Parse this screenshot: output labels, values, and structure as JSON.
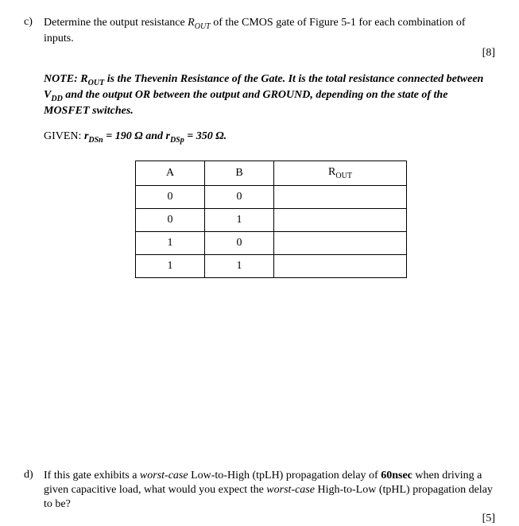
{
  "question_c": {
    "letter": "c)",
    "text_prefix": "Determine the output resistance ",
    "rout_symbol": "R",
    "rout_sub": "OUT",
    "text_middle": " of the CMOS gate of Figure 5-1 for each combination of inputs.",
    "marks": "[8]"
  },
  "note": {
    "label": "NOTE:  ",
    "r_prefix": "R",
    "r_sub": "OUT",
    "text1": " is the Thevenin Resistance of the Gate.  It is the total resistance connected between V",
    "vdd_sub": "DD",
    "text2": " and the output OR between the output and GROUND, depending on the state of the MOSFET switches."
  },
  "given": {
    "label": "GIVEN:   ",
    "rdsn_prefix": "r",
    "rdsn_sub": "DSn",
    "rdsn_val": " = 190 Ω",
    "and": " and ",
    "rdsp_prefix": "r",
    "rdsp_sub": "DSp",
    "rdsp_val": " = 350 Ω."
  },
  "table": {
    "headers": {
      "a": "A",
      "b": "B",
      "rout_prefix": "R",
      "rout_sub": "OUT"
    },
    "rows": [
      {
        "a": "0",
        "b": "0",
        "rout": ""
      },
      {
        "a": "0",
        "b": "1",
        "rout": ""
      },
      {
        "a": "1",
        "b": "0",
        "rout": ""
      },
      {
        "a": "1",
        "b": "1",
        "rout": ""
      }
    ]
  },
  "question_d": {
    "letter": "d)",
    "text1": "If this gate exhibits a ",
    "worst_case": "worst-case",
    "text2": " Low-to-High (tpLH) propagation delay of ",
    "delay": "60nsec",
    "text3": " when driving a given capacitive load, what would you expect the ",
    "text4": " High-to-Low (tpHL) propagation delay to be?",
    "marks": "[5]"
  }
}
